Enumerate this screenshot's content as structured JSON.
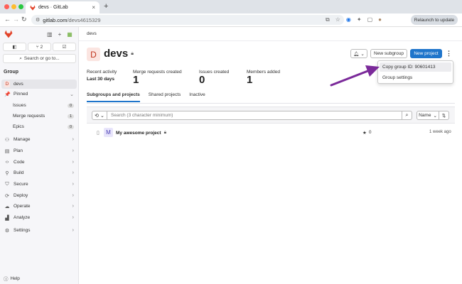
{
  "browser": {
    "tab_title": "devs · GitLab",
    "url_host": "gitlab.com",
    "url_path": "/devs4615329",
    "relaunch_label": "Relaunch to update"
  },
  "sidebar": {
    "merge_count": "2",
    "search_label": "Search or go to...",
    "group_label": "Group",
    "group_name": "devs",
    "pinned_label": "Pinned",
    "pinned_items": [
      {
        "label": "Issues",
        "count": "0"
      },
      {
        "label": "Merge requests",
        "count": "1"
      },
      {
        "label": "Epics",
        "count": "0"
      }
    ],
    "sections": [
      "Manage",
      "Plan",
      "Code",
      "Build",
      "Secure",
      "Deploy",
      "Operate",
      "Analyze"
    ],
    "settings_label": "Settings",
    "help_label": "Help"
  },
  "main": {
    "breadcrumb": "devs",
    "group_initial": "D",
    "group_title": "devs",
    "new_subgroup_label": "New subgroup",
    "new_project_label": "New project",
    "dropdown": {
      "copy_id": "Copy group ID: 90601413",
      "settings": "Group settings"
    },
    "stats": {
      "recent_label": "Recent activity",
      "recent_period": "Last 30 days",
      "merge_label": "Merge requests created",
      "merge_value": "1",
      "issues_label": "Issues created",
      "issues_value": "0",
      "members_label": "Members added",
      "members_value": "1"
    },
    "tabs": [
      "Subgroups and projects",
      "Shared projects",
      "Inactive"
    ],
    "search_placeholder": "Search (3 character minimum)",
    "sort_label": "Name",
    "project": {
      "initial": "M",
      "name": "My awesome project",
      "stars": "0",
      "updated": "1 week ago"
    }
  },
  "colors": {
    "accent": "#1f75cb",
    "arrow": "#7b2a9a"
  }
}
